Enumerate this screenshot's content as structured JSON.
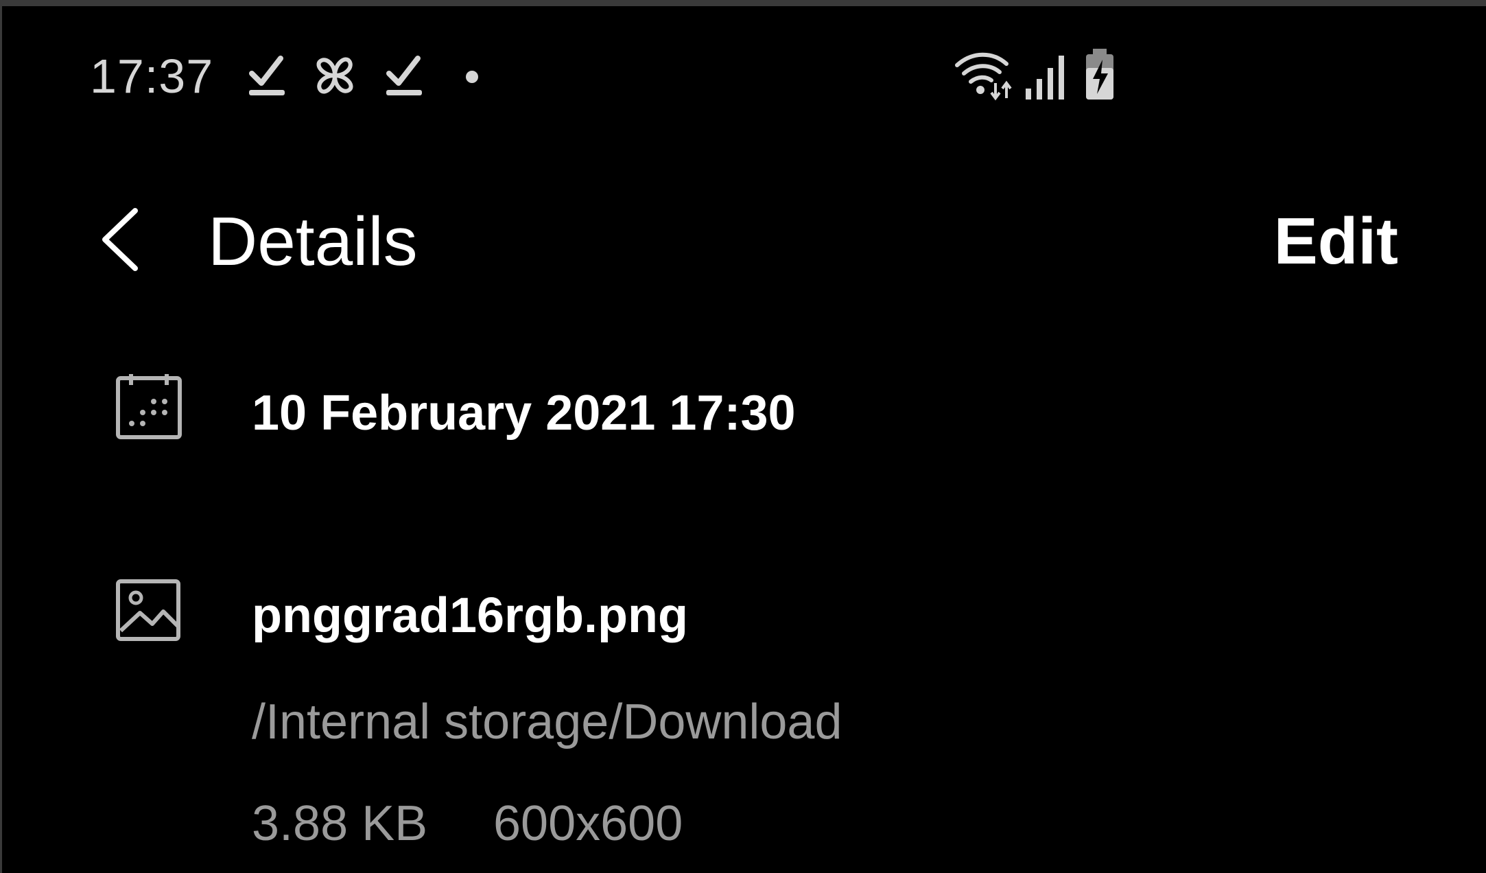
{
  "status_bar": {
    "time": "17:37",
    "left_icons": [
      "download-complete-icon",
      "pinwheel-icon",
      "download-complete-icon",
      "dot-icon"
    ],
    "right_icons": [
      "wifi-icon",
      "signal-icon",
      "battery-charging-icon"
    ]
  },
  "header": {
    "back_icon": "chevron-left-icon",
    "title": "Details",
    "edit_label": "Edit"
  },
  "details": {
    "date": {
      "icon": "calendar-icon",
      "value": "10 February 2021 17:30"
    },
    "file": {
      "icon": "image-icon",
      "name": "pnggrad16rgb.png",
      "path": "/Internal storage/Download",
      "size": "3.88 KB",
      "resolution": "600x600"
    }
  },
  "colors": {
    "background": "#000000",
    "primary_text": "#ffffff",
    "secondary_text": "#9a9a9a",
    "icon": "#b5b5b5"
  }
}
